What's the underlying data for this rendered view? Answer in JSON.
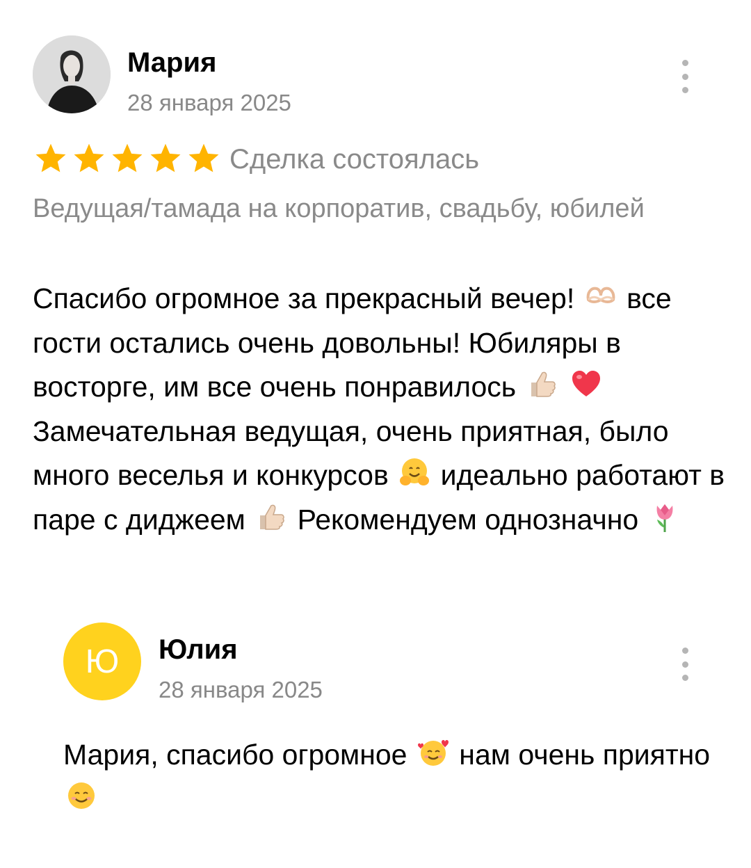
{
  "review": {
    "author": "Мария",
    "date": "28 января 2025",
    "rating": 5,
    "rating_max": 5,
    "status": "Сделка состоялась",
    "service": "Ведущая/тамада на корпоратив, свадьбу, юбилей",
    "text_parts": {
      "p1": "Спасибо огромное за прекрасный вечер!",
      "p2": "все гости остались очень довольны! Юбиляры в восторге, им все очень понравилось",
      "p3": "Замечательная ведущая, очень приятная, было много веселья и конкурсов",
      "p4": "идеально работают в паре с диджеем",
      "p5": "Рекомендуем  однозначно"
    },
    "emojis": [
      "heart-hands-emoji",
      "thumbs-up-emoji",
      "red-heart-emoji",
      "hugging-face-emoji",
      "thumbs-up-emoji",
      "tulip-emoji"
    ]
  },
  "reply": {
    "author": "Юлия",
    "avatar_letter": "Ю",
    "avatar_color": "#ffd21e",
    "date": "28 января 2025",
    "text_parts": {
      "p1": "Мария, спасибо огромное",
      "p2": "нам очень приятно"
    },
    "emojis": [
      "smiling-face-with-hearts-emoji",
      "smiling-face-emoji"
    ]
  },
  "colors": {
    "star": "#ffb400",
    "muted_text": "#8a8a8a",
    "kebab": "#b5b5b5"
  }
}
